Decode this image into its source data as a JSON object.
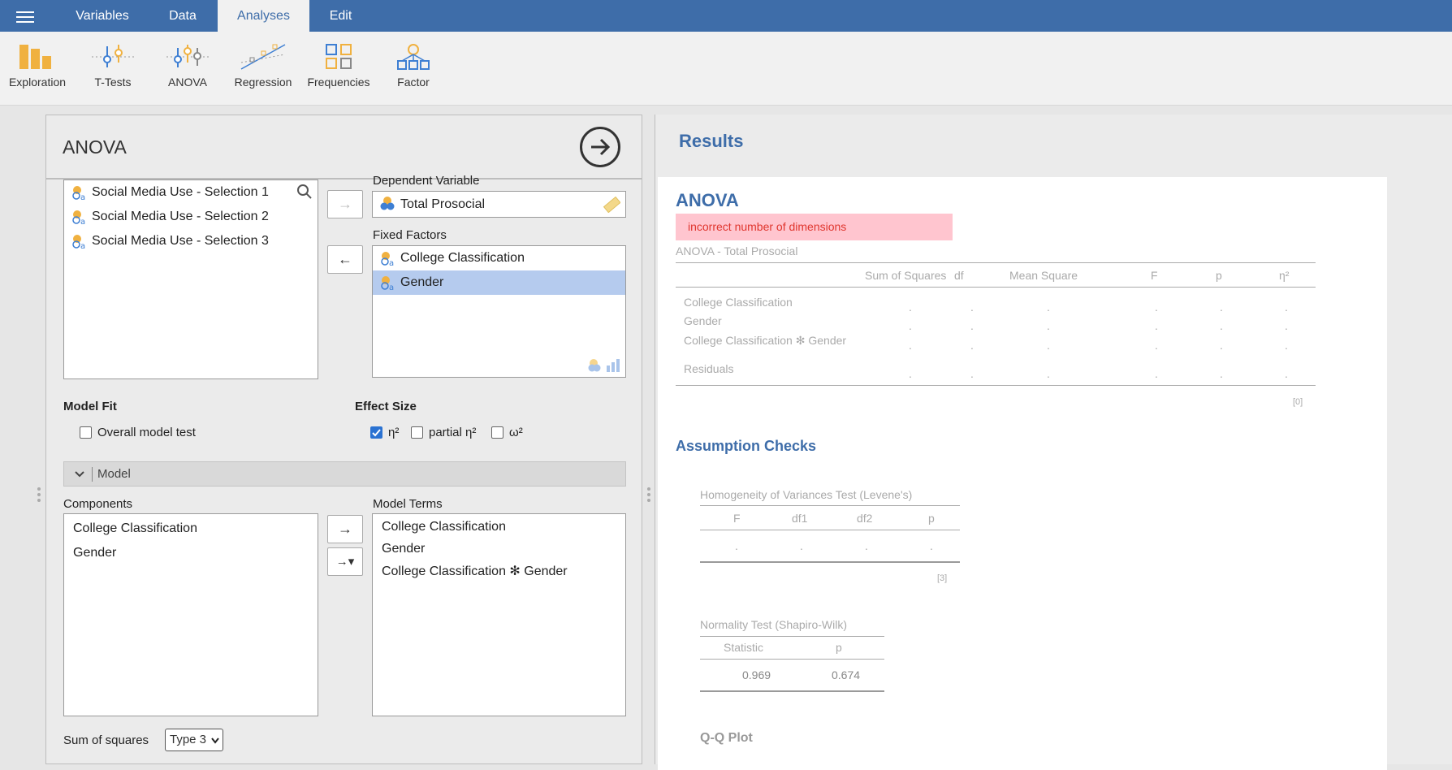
{
  "menu": {
    "tabs": [
      {
        "label": "Variables"
      },
      {
        "label": "Data"
      },
      {
        "label": "Analyses"
      },
      {
        "label": "Edit"
      }
    ]
  },
  "ribbon": {
    "items": [
      {
        "label": "Exploration",
        "icon": "exploration-icon"
      },
      {
        "label": "T-Tests",
        "icon": "ttests-icon"
      },
      {
        "label": "ANOVA",
        "icon": "anova-icon"
      },
      {
        "label": "Regression",
        "icon": "regression-icon"
      },
      {
        "label": "Frequencies",
        "icon": "frequencies-icon"
      },
      {
        "label": "Factor",
        "icon": "factor-icon"
      }
    ]
  },
  "options": {
    "title": "ANOVA",
    "variables": [
      "Social Media Use - Selection 1",
      "Social Media Use - Selection 2",
      "Social Media Use - Selection 3"
    ],
    "dependent_label": "Dependent Variable",
    "dependent_value": "Total Prosocial",
    "fixed_label": "Fixed Factors",
    "fixed_factors": [
      "College Classification",
      "Gender"
    ],
    "model_fit_label": "Model Fit",
    "overall_model_test": "Overall model test",
    "effect_size_label": "Effect Size",
    "eta_sq": "η²",
    "partial_eta_sq": "partial η²",
    "omega_sq": "ω²",
    "model_section": "Model",
    "components_label": "Components",
    "components": [
      "College Classification",
      "Gender"
    ],
    "model_terms_label": "Model Terms",
    "model_terms": [
      "College Classification",
      "Gender",
      "College Classification ✻ Gender"
    ],
    "sum_squares_label": "Sum of squares",
    "sum_squares_value": "Type 3"
  },
  "results": {
    "title": "Results",
    "anova_title": "ANOVA",
    "error": "incorrect number of dimensions",
    "table_caption": "ANOVA - Total Prosocial",
    "headers": [
      "Sum of Squares",
      "df",
      "Mean Square",
      "F",
      "p",
      "η²"
    ],
    "rows": [
      "College Classification",
      "Gender",
      "College Classification ✻ Gender",
      "Residuals"
    ],
    "footnote": "[0]",
    "assumption_title": "Assumption Checks",
    "levene_caption": "Homogeneity of Variances Test (Levene's)",
    "levene_headers": [
      "F",
      "df1",
      "df2",
      "p"
    ],
    "levene_footnote": "[3]",
    "normality_caption": "Normality Test (Shapiro-Wilk)",
    "normality_headers": [
      "Statistic",
      "p"
    ],
    "normality_values": [
      "0.969",
      "0.674"
    ],
    "qq_title": "Q-Q Plot",
    "empty_cell": "."
  },
  "colors": {
    "topbar": "#3e6da9",
    "accent": "#3e6da9",
    "error_bg": "#ffc5cf",
    "error_text": "#e0362e",
    "selection": "#b5cbee",
    "icon_orange": "#f0b140",
    "icon_blue": "#3e7fd3"
  }
}
